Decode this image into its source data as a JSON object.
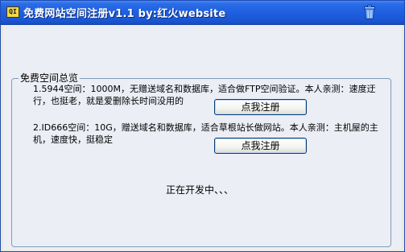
{
  "window": {
    "title": "免费网站空间注册v1.1  by:红火website",
    "icon_label": "QI"
  },
  "group": {
    "legend": "免费空间总览"
  },
  "hosts": [
    {
      "description": "1.5944空间：1000M，无赠送域名和数据库，适合做FTP空间验证。本人亲测：速度迂行，也挺老，就是爱删除长时间没用的",
      "button_label": "点我注册"
    },
    {
      "description": "2.ID666空间：10G，赠送域名和数据库，适合草根站长做网站。本人亲测：主机屋的主机，速度快，挺稳定",
      "button_label": "点我注册"
    }
  ],
  "status_text": "正在开发中、、、",
  "colors": {
    "titlebar": "#1e5fe0",
    "client_bg": "#ebeef5",
    "group_border": "#7f9db9",
    "button_border": "#003c74"
  }
}
